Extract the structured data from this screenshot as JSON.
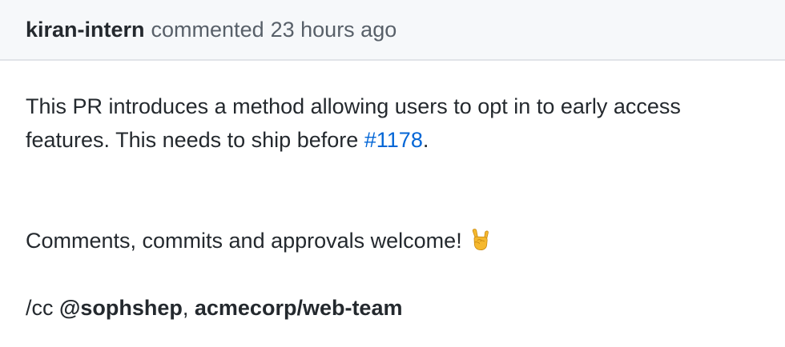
{
  "comment": {
    "author": "kiran-intern",
    "action": "commented",
    "timestamp": "23 hours ago",
    "body": {
      "paragraph1_text": "This PR introduces a method allowing users to opt in to early access features. This needs to ship before ",
      "issue_ref": "#1178",
      "paragraph1_end": ".",
      "paragraph2_text": "Comments, commits and approvals welcome! ",
      "paragraph2_emoji": "sign-of-the-horns-emoji",
      "cc_prefix": "/cc ",
      "mention_user": "@sophshep",
      "mention_separator": ", ",
      "mention_team": "acmecorp/web-team"
    }
  },
  "colors": {
    "header_background": "#f6f8fa",
    "header_border": "#e1e4e8",
    "text_primary": "#24292e",
    "text_muted": "#586069",
    "link": "#0366d6",
    "emoji_fill": "#f5b82e"
  }
}
